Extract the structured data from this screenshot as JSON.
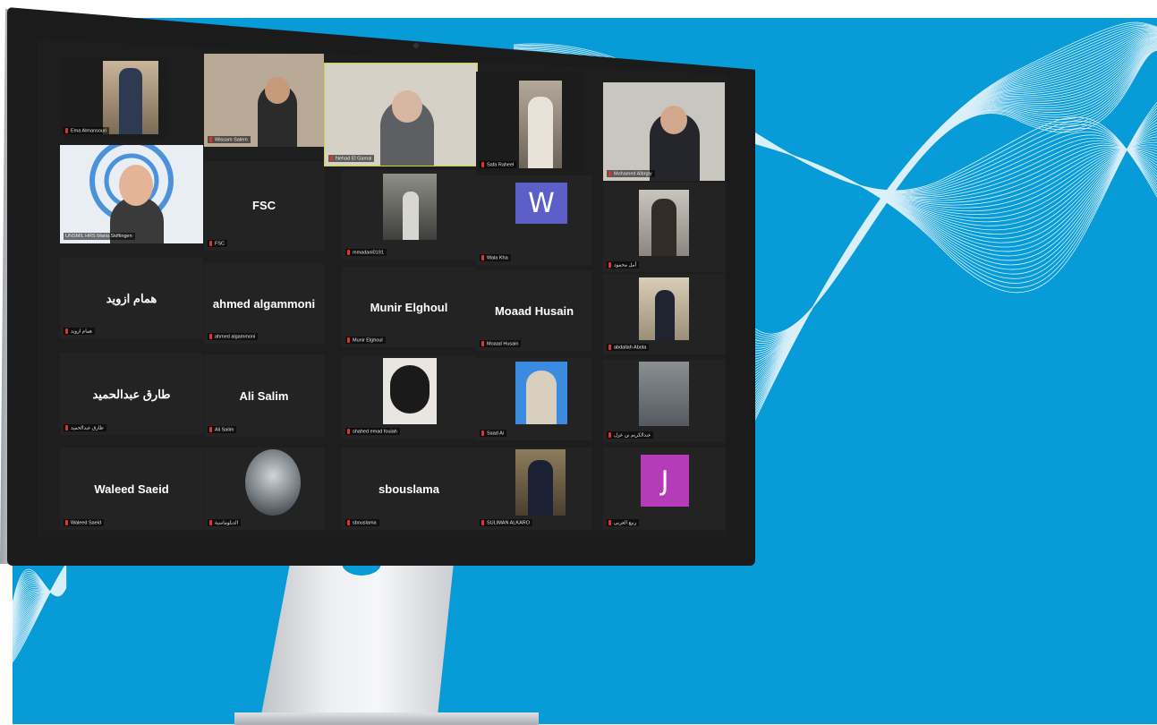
{
  "colors": {
    "background": "#079bd8",
    "screen": "#1e1e1e",
    "tile": "#232323",
    "mic_muted": "#e0332c",
    "avatar_w": "#5b5fc7",
    "avatar_j": "#b53bb8"
  },
  "meeting": {
    "participants": [
      {
        "id": "p1",
        "display_name": "Ema Almansouri",
        "center_name": "",
        "type": "video"
      },
      {
        "id": "p2",
        "display_name": "Wissam Salem",
        "center_name": "",
        "type": "video"
      },
      {
        "id": "p3",
        "display_name": "Nehad El Gamal",
        "center_name": "",
        "type": "video"
      },
      {
        "id": "p4",
        "display_name": "Safa Raheel",
        "center_name": "",
        "type": "video"
      },
      {
        "id": "p5",
        "display_name": "Mohamed Albrgly",
        "center_name": "",
        "type": "video"
      },
      {
        "id": "p6",
        "display_name": "UNSMIL HRS Maria Skiftingen",
        "center_name": "",
        "type": "video"
      },
      {
        "id": "p7",
        "display_name": "FSC",
        "center_name": "FSC",
        "type": "name"
      },
      {
        "id": "p8",
        "display_name": "mmadani0191",
        "center_name": "",
        "type": "photo"
      },
      {
        "id": "p9",
        "display_name": "Wala Kha",
        "center_name": "",
        "type": "avatar",
        "letter": "W"
      },
      {
        "id": "p10",
        "display_name": "أمل محمود",
        "center_name": "",
        "type": "photo"
      },
      {
        "id": "p11",
        "display_name": "همام ازويد",
        "center_name": "همام ازويد",
        "type": "name"
      },
      {
        "id": "p12",
        "display_name": "ahmed algammoni",
        "center_name": "ahmed algammoni",
        "type": "name"
      },
      {
        "id": "p13",
        "display_name": "Munir Elghoul",
        "center_name": "Munir Elghoul",
        "type": "name"
      },
      {
        "id": "p14",
        "display_name": "Moaad Husain",
        "center_name": "Moaad Husain",
        "type": "name"
      },
      {
        "id": "p15",
        "display_name": "abdallah Abota",
        "center_name": "",
        "type": "photo"
      },
      {
        "id": "p16",
        "display_name": "طارق عبدالحميد",
        "center_name": "طارق عبدالحميد",
        "type": "name"
      },
      {
        "id": "p17",
        "display_name": "Ali Salim",
        "center_name": "Ali Salim",
        "type": "name"
      },
      {
        "id": "p18",
        "display_name": "shahed emad fouiah",
        "center_name": "",
        "type": "photo"
      },
      {
        "id": "p19",
        "display_name": "Saad Ai",
        "center_name": "",
        "type": "photo"
      },
      {
        "id": "p20",
        "display_name": "عبدالكريم بن عزل",
        "center_name": "",
        "type": "photo"
      },
      {
        "id": "p21",
        "display_name": "Waleed Saeid",
        "center_name": "Waleed Saeid",
        "type": "name"
      },
      {
        "id": "p22",
        "display_name": "الدبلوماسية",
        "center_name": "",
        "type": "photo"
      },
      {
        "id": "p23",
        "display_name": "sbouslama",
        "center_name": "sbouslama",
        "type": "name"
      },
      {
        "id": "p24",
        "display_name": "SULIMAN ALKARO",
        "center_name": "",
        "type": "photo"
      },
      {
        "id": "p25",
        "display_name": "ربيع العربي",
        "center_name": "",
        "type": "avatar",
        "letter": "J"
      }
    ]
  }
}
